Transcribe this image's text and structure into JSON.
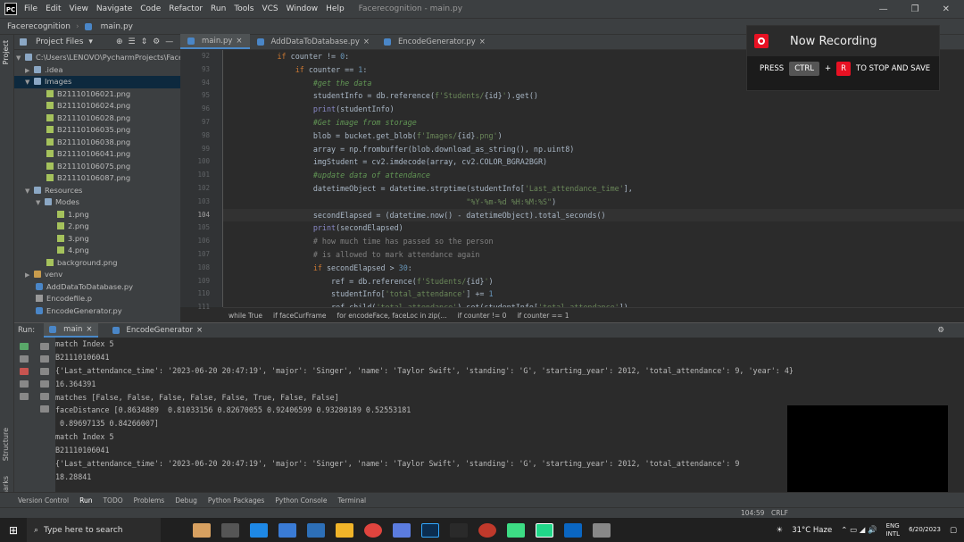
{
  "titlebar": {
    "logo": "PC",
    "menu": [
      "File",
      "Edit",
      "View",
      "Navigate",
      "Code",
      "Refactor",
      "Run",
      "Tools",
      "VCS",
      "Window",
      "Help"
    ],
    "title": "Facerecognition - main.py",
    "minimize": "—",
    "restore": "❐",
    "close": "✕"
  },
  "navbar": {
    "project": "Facerecognition",
    "file": "main.py"
  },
  "sidebar_labels": {
    "project": "Project",
    "structure": "Structure",
    "bookmarks": "Bookmarks"
  },
  "project": {
    "header": "Project Files",
    "root": "C:\\Users\\LENOVO\\PycharmProjects\\Facere",
    "items": [
      {
        "name": ".idea",
        "type": "folder"
      },
      {
        "name": "Images",
        "type": "folder"
      },
      {
        "name": "B21110106021.png"
      },
      {
        "name": "B21110106024.png"
      },
      {
        "name": "B21110106028.png"
      },
      {
        "name": "B21110106035.png"
      },
      {
        "name": "B21110106038.png"
      },
      {
        "name": "B21110106041.png"
      },
      {
        "name": "B21110106075.png"
      },
      {
        "name": "B21110106087.png"
      },
      {
        "name": "Resources"
      },
      {
        "name": "Modes"
      },
      {
        "name": "1.png"
      },
      {
        "name": "2.png"
      },
      {
        "name": "3.png"
      },
      {
        "name": "4.png"
      },
      {
        "name": "background.png"
      },
      {
        "name": "venv"
      },
      {
        "name": "AddDataToDatabase.py"
      },
      {
        "name": "Encodefile.p"
      },
      {
        "name": "EncodeGenerator.py"
      }
    ]
  },
  "editor": {
    "tabs": [
      "main.py",
      "AddDataToDatabase.py",
      "EncodeGenerator.py"
    ],
    "line_numbers": [
      "92",
      "93",
      "94",
      "95",
      "96",
      "97",
      "98",
      "99",
      "100",
      "101",
      "102",
      "103",
      "104",
      "105",
      "106",
      "107",
      "108",
      "109",
      "110",
      "111"
    ],
    "current_line": "104",
    "breadcrumb": [
      "while True",
      "if faceCurFrame",
      "for encodeFace, faceLoc in zip(...",
      "if counter != 0",
      "if counter == 1"
    ]
  },
  "run": {
    "label": "Run:",
    "tabs": [
      "main",
      "EncodeGenerator"
    ],
    "output": [
      "match Index 5",
      "B21110106041",
      "{'Last_attendance_time': '2023-06-20 20:47:19', 'major': 'Singer', 'name': 'Taylor Swift', 'standing': 'G', 'starting_year': 2012, 'total_attendance': 9, 'year': 4}",
      "16.364391",
      "matches [False, False, False, False, False, True, False, False]",
      "faceDistance [0.8634889  0.81033156 0.82670055 0.92406599 0.93280189 0.52553181",
      " 0.89697135 0.84266007]",
      "match Index 5",
      "B21110106041",
      "{'Last_attendance_time': '2023-06-20 20:47:19', 'major': 'Singer', 'name': 'Taylor Swift', 'standing': 'G', 'starting_year': 2012, 'total_attendance': 9",
      "18.28841"
    ]
  },
  "bottombar": [
    "Version Control",
    "Run",
    "TODO",
    "Problems",
    "Debug",
    "Python Packages",
    "Python Console",
    "Terminal"
  ],
  "statusbar": {
    "position": "104:59",
    "encoding": "CRLF"
  },
  "taskbar": {
    "search": "Type here to search",
    "weather": "31°C  Haze",
    "lang": "ENG",
    "lang2": "INTL",
    "time": "",
    "date": "6/20/2023"
  },
  "overlay": {
    "title": "Now Recording",
    "press": "PRESS",
    "key1": "CTRL",
    "plus": "+",
    "key2": "R",
    "action": "TO STOP AND SAVE"
  }
}
